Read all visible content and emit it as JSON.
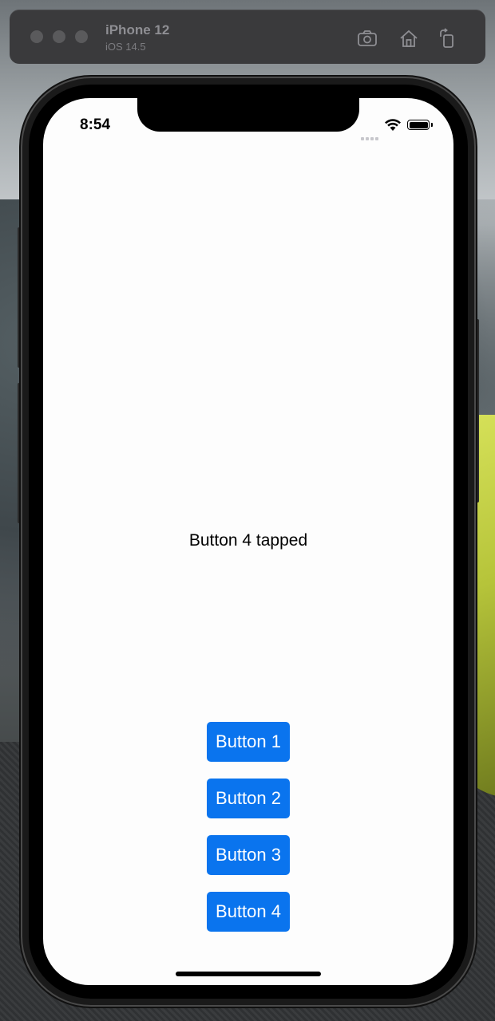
{
  "simulator": {
    "device_name": "iPhone 12",
    "os_version": "iOS 14.5",
    "toolbar_icons": [
      "screenshot-icon",
      "home-icon",
      "rotate-icon"
    ]
  },
  "status_bar": {
    "time": "8:54",
    "icons": [
      "cellular-signal-icon",
      "wifi-icon",
      "battery-icon"
    ]
  },
  "app": {
    "message": "Button 4 tapped",
    "buttons": [
      {
        "label": "Button 1"
      },
      {
        "label": "Button 2"
      },
      {
        "label": "Button 3"
      },
      {
        "label": "Button 4"
      }
    ]
  },
  "colors": {
    "button_background": "#0a74ee",
    "button_text": "#ffffff",
    "screen_background": "#fdfdfd"
  }
}
